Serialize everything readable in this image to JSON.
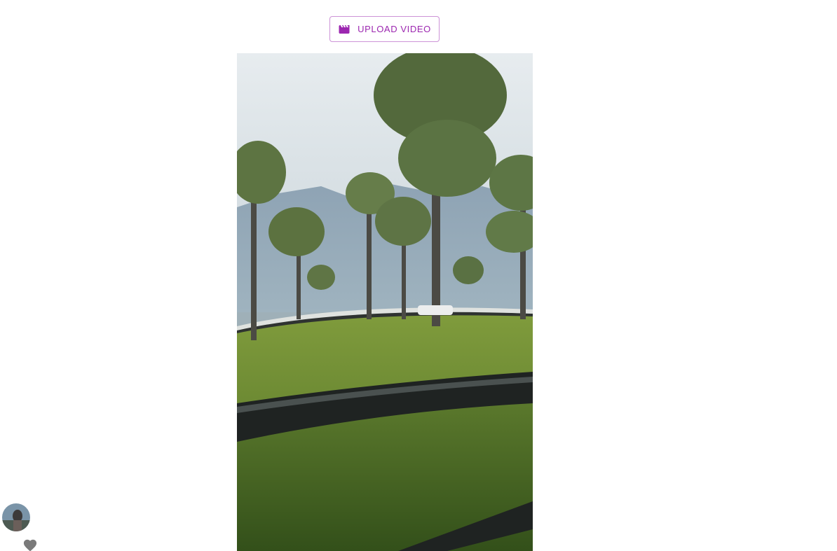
{
  "toolbar": {
    "upload_label": "UPLOAD VIDEO",
    "upload_icon": "movie-clapper-icon",
    "accent_color": "#9c27b0"
  },
  "video": {
    "content": "tea-plantation-scene"
  },
  "user": {
    "avatar_icon": "user-avatar"
  },
  "actions": {
    "like_icon": "heart-icon",
    "like_color": "#7a7a7a"
  }
}
